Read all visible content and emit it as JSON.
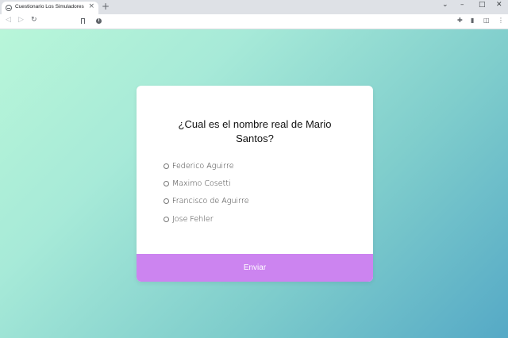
{
  "browser": {
    "tab_title": "Cuestionario Los Simuladores",
    "tab_close": "×",
    "new_tab": "+",
    "window_controls": {
      "dropdown": "⌄",
      "minimize": "–",
      "maximize": "□",
      "close": "✕"
    },
    "nav": {
      "back": "◁",
      "forward": "▷",
      "reload": "↻"
    },
    "info_badge": "i",
    "toolbar_icons": {
      "extensions": "✚",
      "side_panel": "▮",
      "profile": "◫",
      "menu": "⋮"
    }
  },
  "quiz": {
    "question": "¿Cual es el nombre real de Mario Santos?",
    "answers": [
      "Federico Aguirre",
      "Maximo Cosetti",
      "Francisco de Aguirre",
      "Jose Fehler"
    ],
    "submit_label": "Enviar",
    "colors": {
      "submit_bg": "#cc84f0",
      "gradient_start": "#b8f6d9",
      "gradient_end": "#55a9c6"
    }
  }
}
